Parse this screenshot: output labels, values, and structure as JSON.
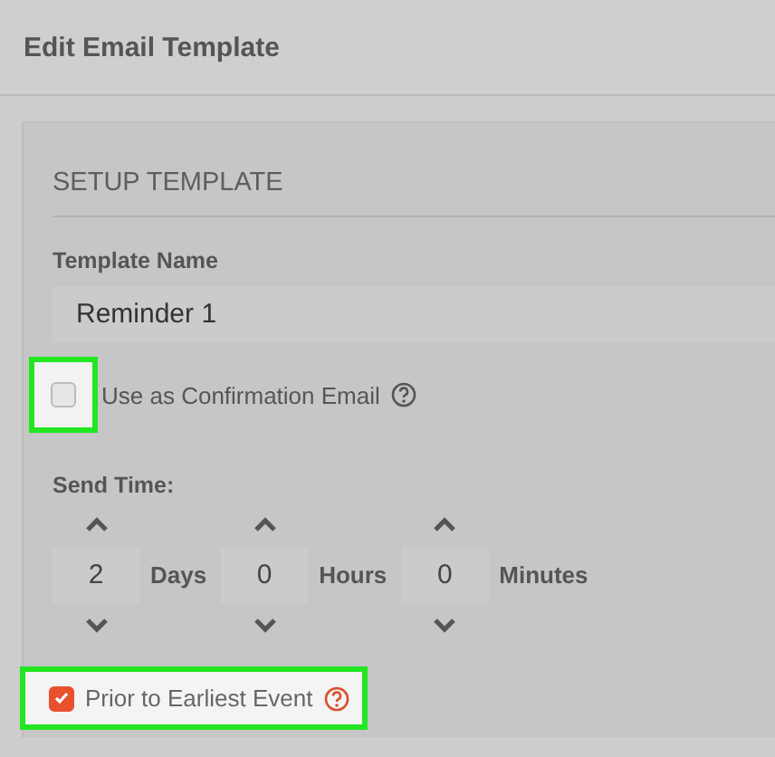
{
  "window": {
    "title": "Edit Email Template"
  },
  "section": {
    "title": "SETUP TEMPLATE"
  },
  "template_name": {
    "label": "Template Name",
    "value": "Reminder 1"
  },
  "options": [
    {
      "label": "Use as Confirmation Email",
      "checked": false,
      "kind": "boxed"
    },
    {
      "label": "Prior to Earliest Event",
      "checked": true,
      "kind": "framed"
    }
  ],
  "send_time": {
    "label": "Send Time:",
    "fields": [
      {
        "value": "2",
        "unit": "Days"
      },
      {
        "value": "0",
        "unit": "Hours"
      },
      {
        "value": "0",
        "unit": "Minutes"
      }
    ]
  }
}
